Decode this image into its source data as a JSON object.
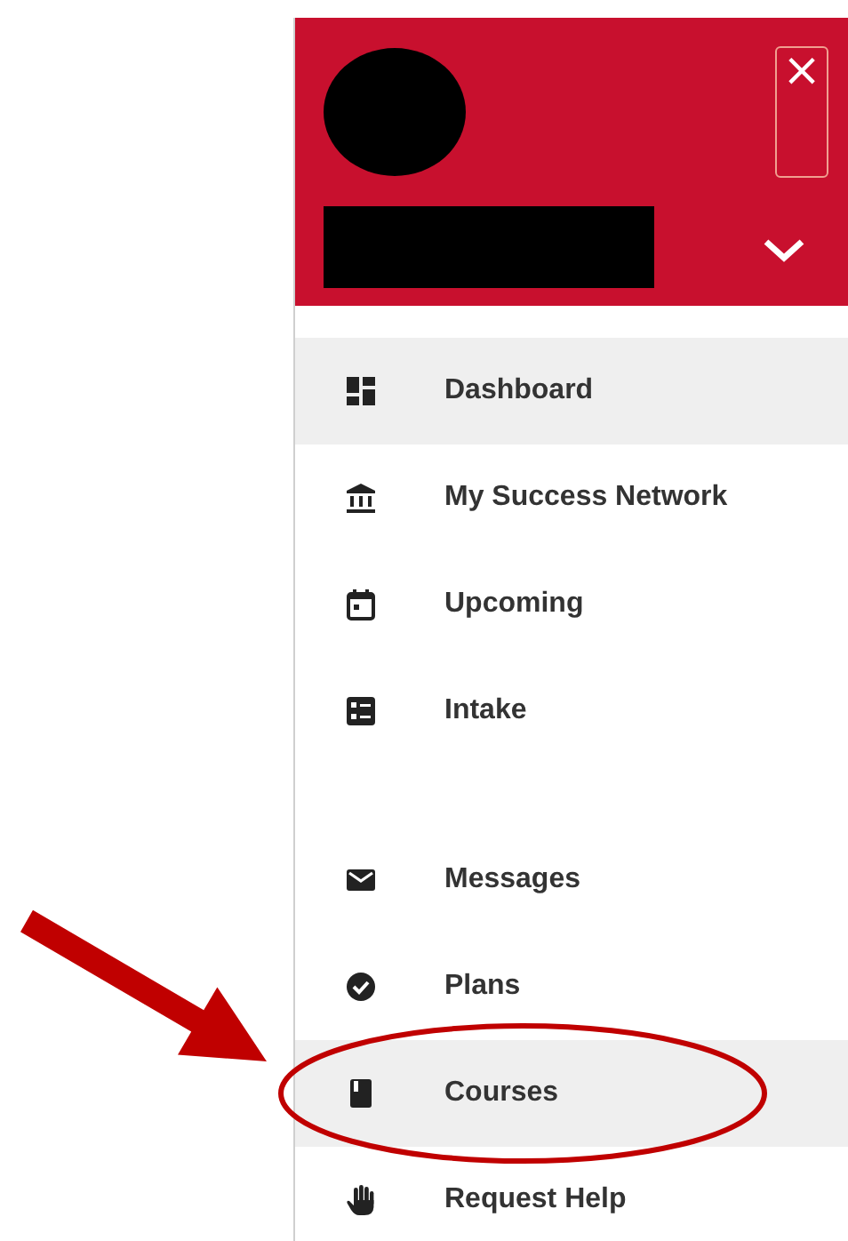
{
  "header": {
    "close_label": "×"
  },
  "menu_sections": [
    {
      "items": [
        {
          "label": "Dashboard",
          "selected": true,
          "circled": false
        },
        {
          "label": "My Success Network",
          "selected": false,
          "circled": false
        },
        {
          "label": "Upcoming",
          "selected": false,
          "circled": false
        },
        {
          "label": "Intake",
          "selected": false,
          "circled": false
        }
      ]
    },
    {
      "items": [
        {
          "label": "Messages",
          "selected": false,
          "circled": false
        },
        {
          "label": "Plans",
          "selected": false,
          "circled": false
        },
        {
          "label": "Courses",
          "selected": true,
          "circled": true
        },
        {
          "label": "Request Help",
          "selected": false,
          "circled": false
        }
      ]
    }
  ]
}
